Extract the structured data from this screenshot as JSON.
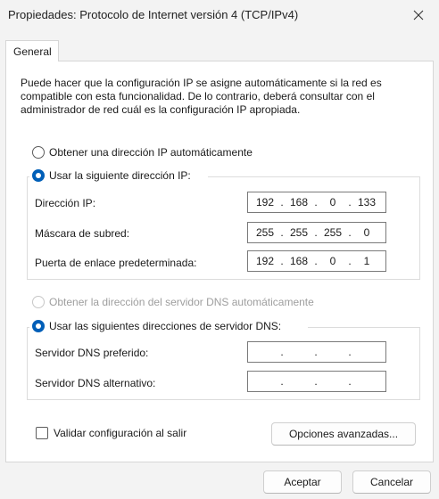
{
  "window": {
    "title": "Propiedades: Protocolo de Internet versión 4 (TCP/IPv4)",
    "close_icon": "close-icon"
  },
  "tabs": [
    {
      "label": "General",
      "selected": true
    }
  ],
  "description": "Puede hacer que la configuración IP se asigne automáticamente si la red es compatible con esta funcionalidad. De lo contrario, deberá consultar con el administrador de red cuál es la configuración IP apropiada.",
  "ip_section": {
    "auto_option": {
      "label": "Obtener una dirección IP automáticamente",
      "checked": false
    },
    "manual_option": {
      "label": "Usar la siguiente dirección IP:",
      "checked": true
    },
    "fields": [
      {
        "label": "Dirección IP:",
        "octets": [
          "192",
          "168",
          "0",
          "133"
        ]
      },
      {
        "label": "Máscara de subred:",
        "octets": [
          "255",
          "255",
          "255",
          "0"
        ]
      },
      {
        "label": "Puerta de enlace predeterminada:",
        "octets": [
          "192",
          "168",
          "0",
          "1"
        ]
      }
    ]
  },
  "dns_section": {
    "auto_option": {
      "label": "Obtener la dirección del servidor DNS automáticamente",
      "checked": false,
      "disabled": true
    },
    "manual_option": {
      "label": "Usar las siguientes direcciones de servidor DNS:",
      "checked": true
    },
    "fields": [
      {
        "label": "Servidor DNS preferido:",
        "octets": [
          "",
          "",
          "",
          ""
        ]
      },
      {
        "label": "Servidor DNS alternativo:",
        "octets": [
          "",
          "",
          "",
          ""
        ]
      }
    ]
  },
  "validate_checkbox": {
    "label": "Validar configuración al salir",
    "checked": false
  },
  "advanced_button": "Opciones avanzadas...",
  "footer": {
    "ok_label": "Aceptar",
    "cancel_label": "Cancelar"
  }
}
